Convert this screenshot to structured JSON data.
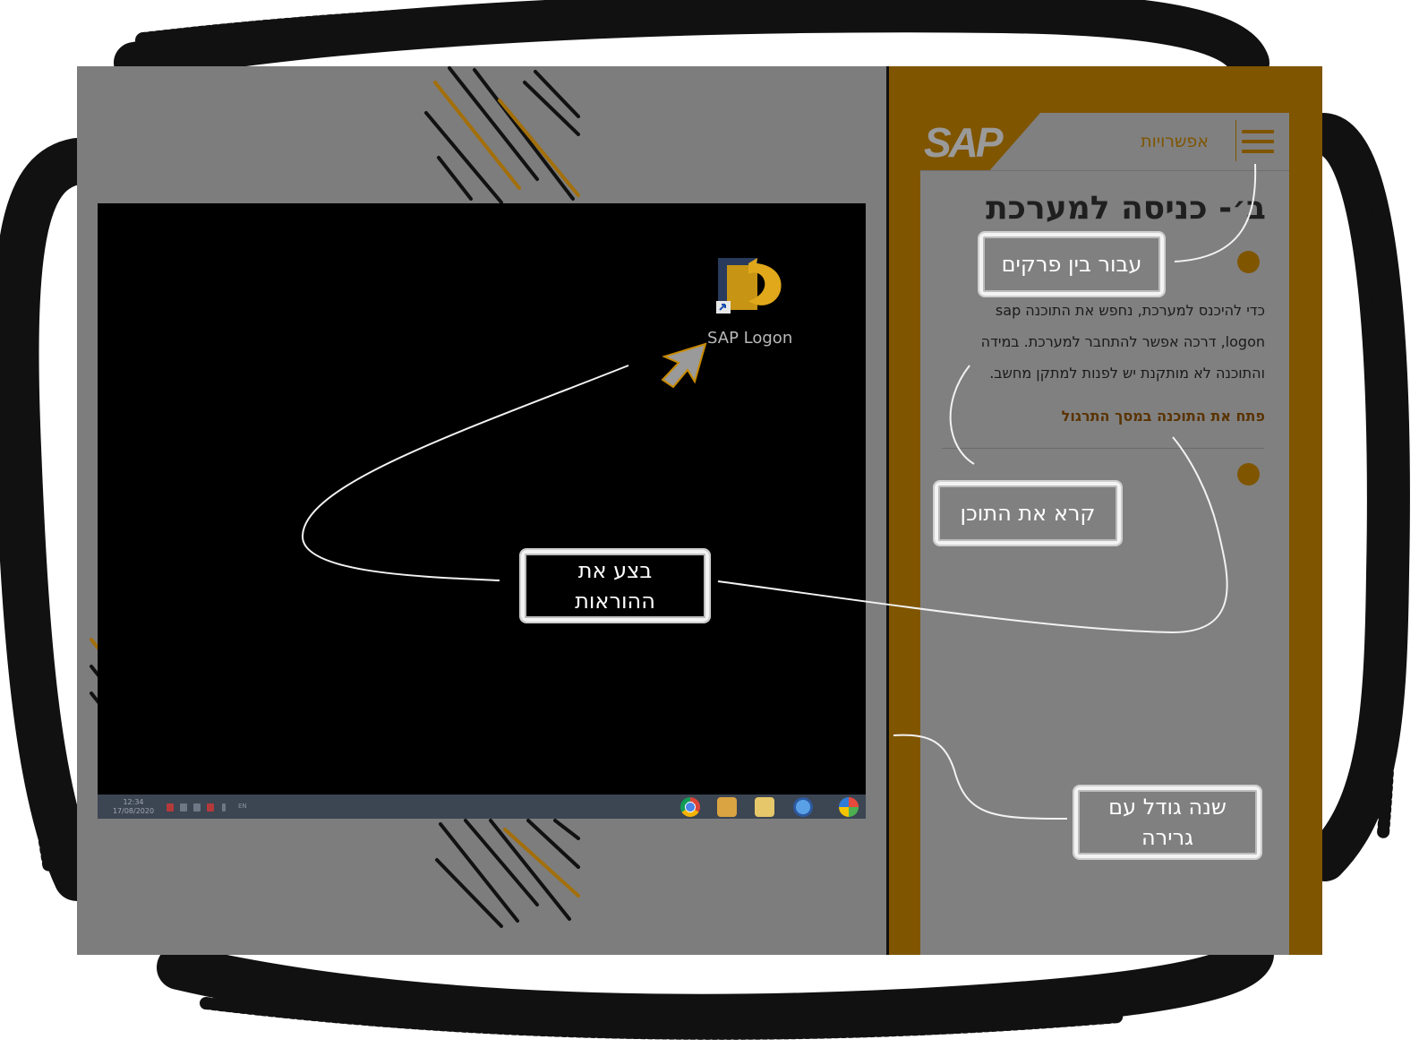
{
  "sidebar": {
    "options_label": "אפשרויות",
    "logo_text": "SAP",
    "chapter_title": "ב׳- כניסה למערכת",
    "paragraph_lines": [
      "כדי להיכנס למערכת, נחפש את התוכנה sap",
      "logon, דרכה אפשר להתחבר למערכת. במידה",
      "והתוכנה לא מותקנת יש לפנות למתקן מחשב."
    ],
    "open_link": "פתח את התוכנה במסך התרגול"
  },
  "desktop": {
    "icon_label": "SAP Logon",
    "clock_time": "12:34",
    "clock_date": "17/08/2020",
    "lang": "EN"
  },
  "callouts": {
    "switch_chapters": "עבור בין פרקים",
    "read_content": "קרא את התוכן",
    "do_instructions_line1": "בצע את",
    "do_instructions_line2": "ההוראות",
    "resize_line1": "שנה גודל עם",
    "resize_line2": "גרירה"
  },
  "colors": {
    "accent": "#7f5500",
    "panel_gray": "#808080",
    "desktop_black": "#000000"
  }
}
